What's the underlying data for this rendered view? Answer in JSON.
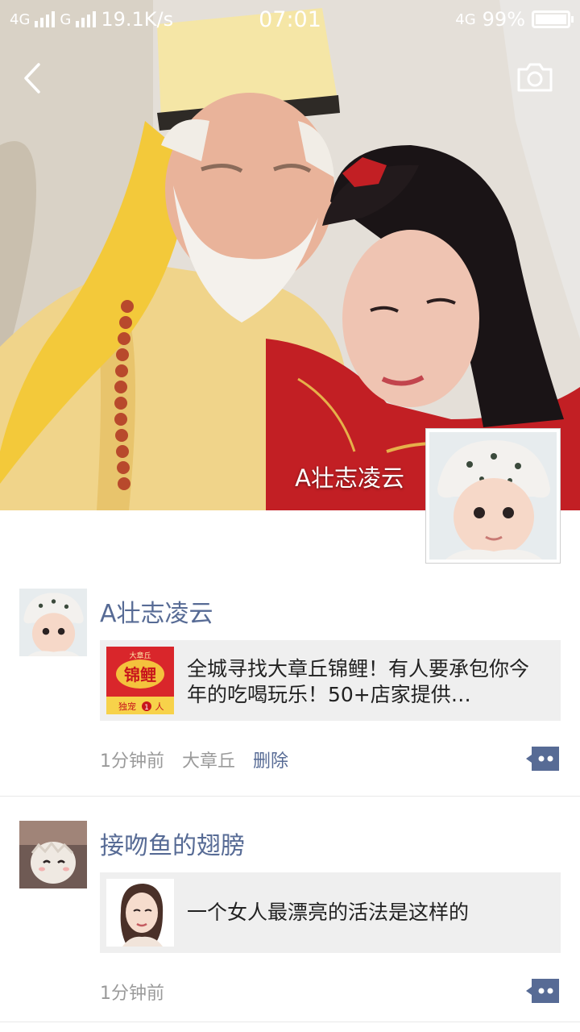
{
  "status_bar": {
    "network_1": "4G",
    "network_2": "G",
    "speed": "19.1K/s",
    "time": "07:01",
    "network_3": "4G",
    "battery": "99%"
  },
  "header": {
    "back_icon": "chevron-left-icon",
    "camera_icon": "camera-icon"
  },
  "profile": {
    "name": "A壮志凌云"
  },
  "posts": [
    {
      "author": "A壮志凌云",
      "link_title": "全城寻找大章丘锦鲤！有人要承包你今年的吃喝玩乐！50+店家提供…",
      "thumb_text": {
        "top": "大章丘",
        "main": "锦鲤",
        "bottom": "独宠",
        "count": "1",
        "unit": "人"
      },
      "time": "1分钟前",
      "location": "大章丘",
      "delete_label": "删除"
    },
    {
      "author": "接吻鱼的翅膀",
      "link_title": "一个女人最漂亮的活法是这样的",
      "time": "1分钟前"
    }
  ],
  "colors": {
    "link_blue": "#576b95",
    "meta_gray": "#9a9a9a",
    "card_bg": "#efefef"
  }
}
